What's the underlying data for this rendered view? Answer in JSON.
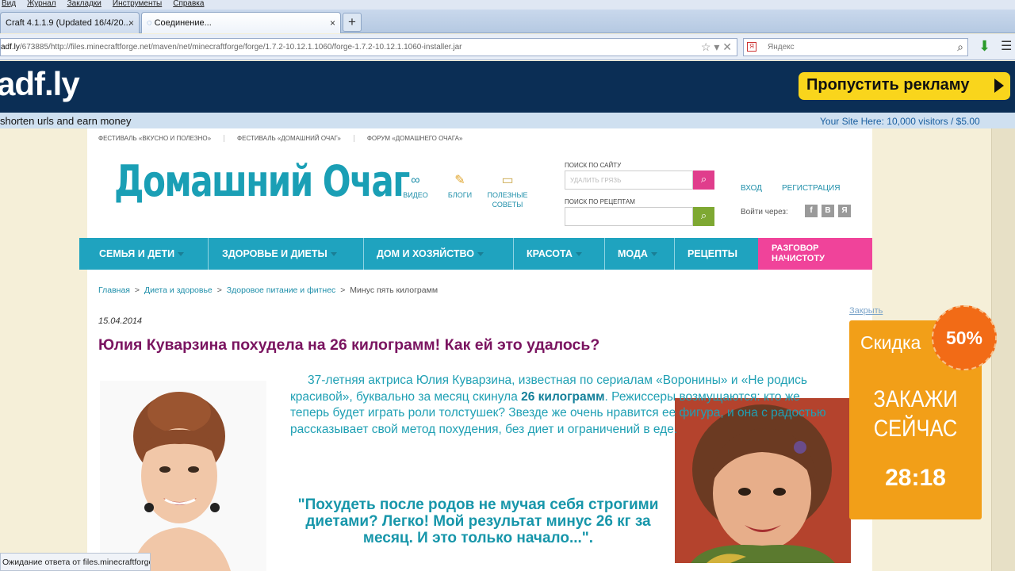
{
  "browser": {
    "menu": [
      "Вид",
      "Журнал",
      "Закладки",
      "Инструменты",
      "Справка"
    ],
    "tabs": [
      {
        "label": "Craft 4.1.1.9 (Updated 16/4/20..."
      },
      {
        "label": "Соединение..."
      }
    ],
    "new_tab": "+",
    "url_host": "adf.ly",
    "url_rest": "/673885/http://files.minecraftforge.net/maven/net/minecraftforge/forge/1.7.2-10.12.1.1060/forge-1.7.2-10.12.1.1060-installer.jar",
    "search_placeholder": "Яндекс",
    "status": "Ожидание ответа от files.minecraftforge.net..."
  },
  "adfly": {
    "logo": "adf.ly",
    "skip_button": "Пропустить рекламу",
    "tagline": "shorten urls and earn money",
    "offer": "Your Site Here: 10,000 visitors / $5.00"
  },
  "site": {
    "top_links": [
      "ФЕСТИВАЛЬ «ВКУСНО И ПОЛЕЗНО»",
      "ФЕСТИВАЛЬ «ДОМАШНИЙ ОЧАГ»",
      "ФОРУМ «ДОМАШНЕГО ОЧАГА»"
    ],
    "logo": "Домашний Очаг",
    "quick": {
      "video": "ВИДЕО",
      "blogs": "БЛОГИ",
      "tips_1": "ПОЛЕЗНЫЕ",
      "tips_2": "СОВЕТЫ"
    },
    "search_site_label": "ПОИСК ПО САЙТУ",
    "search_site_placeholder": "УДАЛИТЬ ГРЯЗЬ",
    "search_recipes_label": "ПОИСК ПО РЕЦЕПТАМ",
    "login": "ВХОД",
    "register": "РЕГИСТРАЦИЯ",
    "enter_via": "Войти через:",
    "social": [
      "f",
      "В",
      "Я"
    ],
    "nav": [
      "СЕМЬЯ И ДЕТИ",
      "ЗДОРОВЬЕ И ДИЕТЫ",
      "ДОМ И ХОЗЯЙСТВО",
      "КРАСОТА",
      "МОДА",
      "РЕЦЕПТЫ"
    ],
    "nav_pink_1": "РАЗГОВОР",
    "nav_pink_2": "НАЧИСТОТУ"
  },
  "breadcrumb": [
    "Главная",
    "Диета и здоровье",
    "Здоровое питание и фитнес",
    "Минус пять килограмм"
  ],
  "article": {
    "date": "15.04.2014",
    "title": "Юлия Куварзина похудела на 26 килограмм! Как ей это удалось?",
    "p_before": "37-летняя актриса Юлия Куварзина, известная по сериалам «Воронины» и «Не родись красивой», буквально за месяц скинула ",
    "p_bold": "26 килограмм",
    "p_after": ". Режиссеры возмущаются: кто же теперь будет играть роли толстушек? Звезде же очень нравится ее фигура, и она с радостью рассказывает свой метод похудения, без диет и ограничений в еде.",
    "quote": "\"Похудеть после родов не мучая себя строгими диетами? Легко! Мой результат минус 26 кг за месяц. И это только начало...\"."
  },
  "promo": {
    "close": "Закрыть",
    "discount_label": "Скидка",
    "discount_value": "50%",
    "order_1": "ЗАКАЖИ",
    "order_2": "СЕЙЧАС",
    "timer": "28:18"
  }
}
